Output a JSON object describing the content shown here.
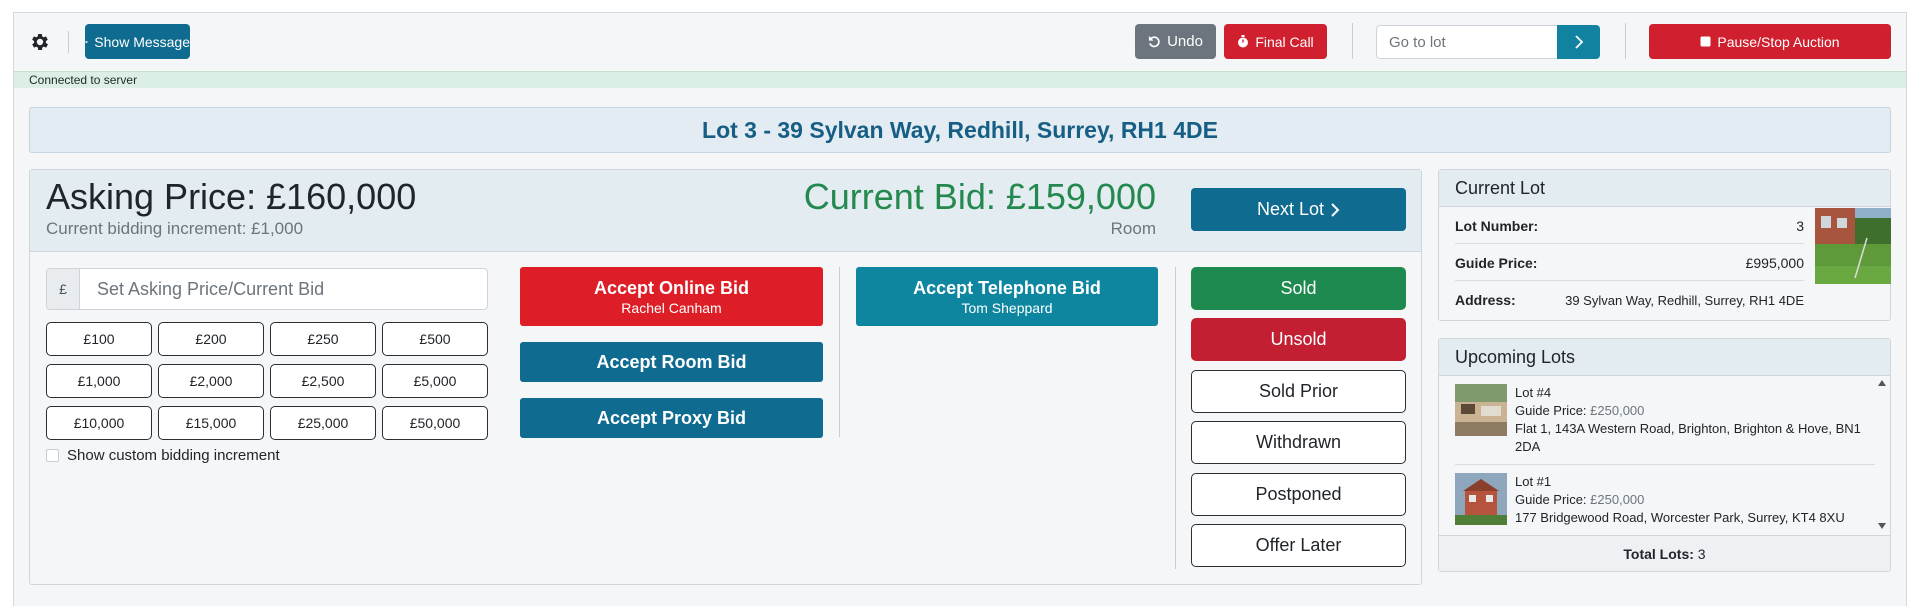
{
  "toolbar": {
    "settings_icon": "gear-icon",
    "show_message_label": "Show Message",
    "show_message_icon": "megaphone-icon",
    "undo_label": "Undo",
    "undo_icon": "undo-icon",
    "final_call_label": "Final Call",
    "final_call_icon": "stopwatch-icon",
    "goto_placeholder": "Go to lot",
    "goto_icon": "chevron-right-icon",
    "pause_label": "Pause/Stop Auction",
    "pause_icon": "stop-icon"
  },
  "status": {
    "text": "Connected to server"
  },
  "lot_title": "Lot 3 - 39 Sylvan Way, Redhill, Surrey, RH1 4DE",
  "bidding": {
    "asking_price": "Asking Price: £160,000",
    "increment": "Current bidding increment: £1,000",
    "current_bid": "Current Bid: £159,000",
    "bid_source": "Room",
    "next_lot_label": "Next Lot",
    "price_prefix": "£",
    "price_placeholder": "Set Asking Price/Current Bid",
    "increments": [
      "£100",
      "£200",
      "£250",
      "£500",
      "£1,000",
      "£2,000",
      "£2,500",
      "£5,000",
      "£10,000",
      "£15,000",
      "£25,000",
      "£50,000"
    ],
    "custom_increment_label": "Show custom bidding increment",
    "accept_online": {
      "label": "Accept Online Bid",
      "bidder": "Rachel Canham"
    },
    "accept_room": {
      "label": "Accept Room Bid"
    },
    "accept_proxy": {
      "label": "Accept Proxy Bid"
    },
    "accept_telephone": {
      "label": "Accept Telephone Bid",
      "bidder": "Tom Sheppard"
    },
    "outcomes": [
      "Sold",
      "Unsold",
      "Sold Prior",
      "Withdrawn",
      "Postponed",
      "Offer Later"
    ]
  },
  "current_lot": {
    "title": "Current Lot",
    "lot_number_label": "Lot Number:",
    "lot_number": "3",
    "guide_label": "Guide Price:",
    "guide_price": "£995,000",
    "address_label": "Address:",
    "address": "39 Sylvan Way, Redhill, Surrey, RH1 4DE"
  },
  "upcoming": {
    "title": "Upcoming Lots",
    "items": [
      {
        "lot": "Lot #4",
        "guide_label": "Guide Price:",
        "guide": "£250,000",
        "address": "Flat 1, 143A Western Road, Brighton, Brighton & Hove, BN1 2DA"
      },
      {
        "lot": "Lot #1",
        "guide_label": "Guide Price:",
        "guide": "£250,000",
        "address": "177 Bridgewood Road, Worcester Park, Surrey, KT4 8XU"
      }
    ],
    "total_label": "Total Lots:",
    "total": "3"
  },
  "colors": {
    "teal": "#0f6b8f",
    "red": "#d01f2e",
    "green": "#1e8a50",
    "telephone": "#0f86a0",
    "bid_green": "#24894e"
  }
}
